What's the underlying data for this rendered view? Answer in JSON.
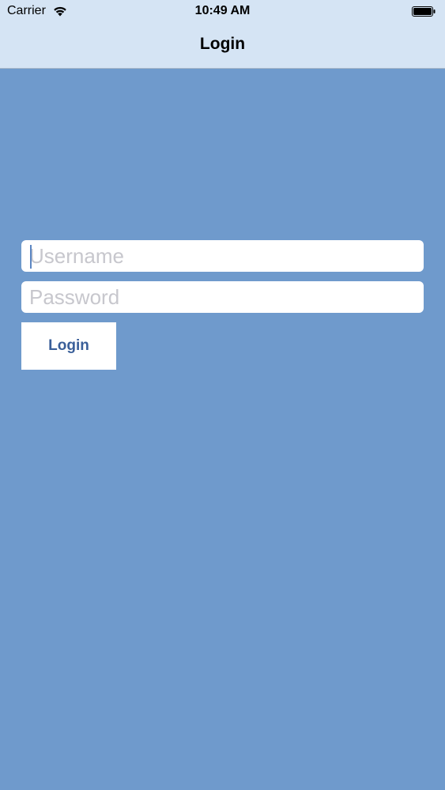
{
  "status_bar": {
    "carrier": "Carrier",
    "time": "10:49 AM",
    "icons": [
      "wifi-icon",
      "battery-icon"
    ]
  },
  "nav": {
    "title": "Login"
  },
  "form": {
    "username_placeholder": "Username",
    "password_placeholder": "Password",
    "login_label": "Login"
  },
  "colors": {
    "background": "#6f9acc",
    "nav_background": "#d5e4f4",
    "button_text": "#3a5f99",
    "placeholder": "#c7c7cd"
  }
}
